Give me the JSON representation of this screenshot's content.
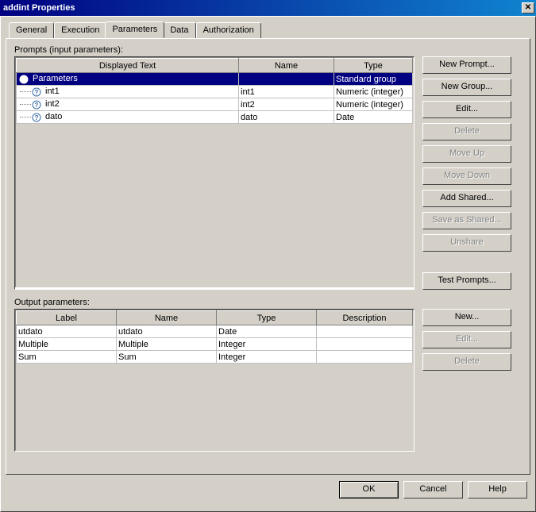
{
  "window": {
    "title": "addint Properties"
  },
  "tabs": [
    "General",
    "Execution",
    "Parameters",
    "Data",
    "Authorization"
  ],
  "activeTab": "Parameters",
  "promptsLabel": "Prompts (input parameters):",
  "outputLabel": "Output parameters:",
  "promptsColumns": [
    "Displayed Text",
    "Name",
    "Type"
  ],
  "promptsRows": [
    {
      "displayed": "Parameters",
      "name": "",
      "type": "Standard group",
      "indent": 0,
      "icon": "group",
      "selected": true
    },
    {
      "displayed": "int1",
      "name": "int1",
      "type": "Numeric (integer)",
      "indent": 1,
      "icon": "prompt",
      "selected": false
    },
    {
      "displayed": "int2",
      "name": "int2",
      "type": "Numeric (integer)",
      "indent": 1,
      "icon": "prompt",
      "selected": false
    },
    {
      "displayed": "dato",
      "name": "dato",
      "type": "Date",
      "indent": 1,
      "icon": "prompt",
      "selected": false
    }
  ],
  "outputColumns": [
    "Label",
    "Name",
    "Type",
    "Description"
  ],
  "outputRows": [
    {
      "label": "utdato",
      "name": "utdato",
      "type": "Date",
      "description": ""
    },
    {
      "label": "Multiple",
      "name": "Multiple",
      "type": "Integer",
      "description": ""
    },
    {
      "label": "Sum",
      "name": "Sum",
      "type": "Integer",
      "description": ""
    }
  ],
  "promptButtons": [
    {
      "label": "New Prompt...",
      "enabled": true
    },
    {
      "label": "New Group...",
      "enabled": true
    },
    {
      "label": "Edit...",
      "enabled": true
    },
    {
      "label": "Delete",
      "enabled": false
    },
    {
      "label": "Move Up",
      "enabled": false
    },
    {
      "label": "Move Down",
      "enabled": false
    },
    {
      "label": "Add Shared...",
      "enabled": true
    },
    {
      "label": "Save as Shared...",
      "enabled": false
    },
    {
      "label": "Unshare",
      "enabled": false
    }
  ],
  "testPromptsLabel": "Test Prompts...",
  "outputButtons": [
    {
      "label": "New...",
      "enabled": true
    },
    {
      "label": "Edit...",
      "enabled": false
    },
    {
      "label": "Delete",
      "enabled": false
    }
  ],
  "bottomButtons": {
    "ok": "OK",
    "cancel": "Cancel",
    "help": "Help"
  }
}
